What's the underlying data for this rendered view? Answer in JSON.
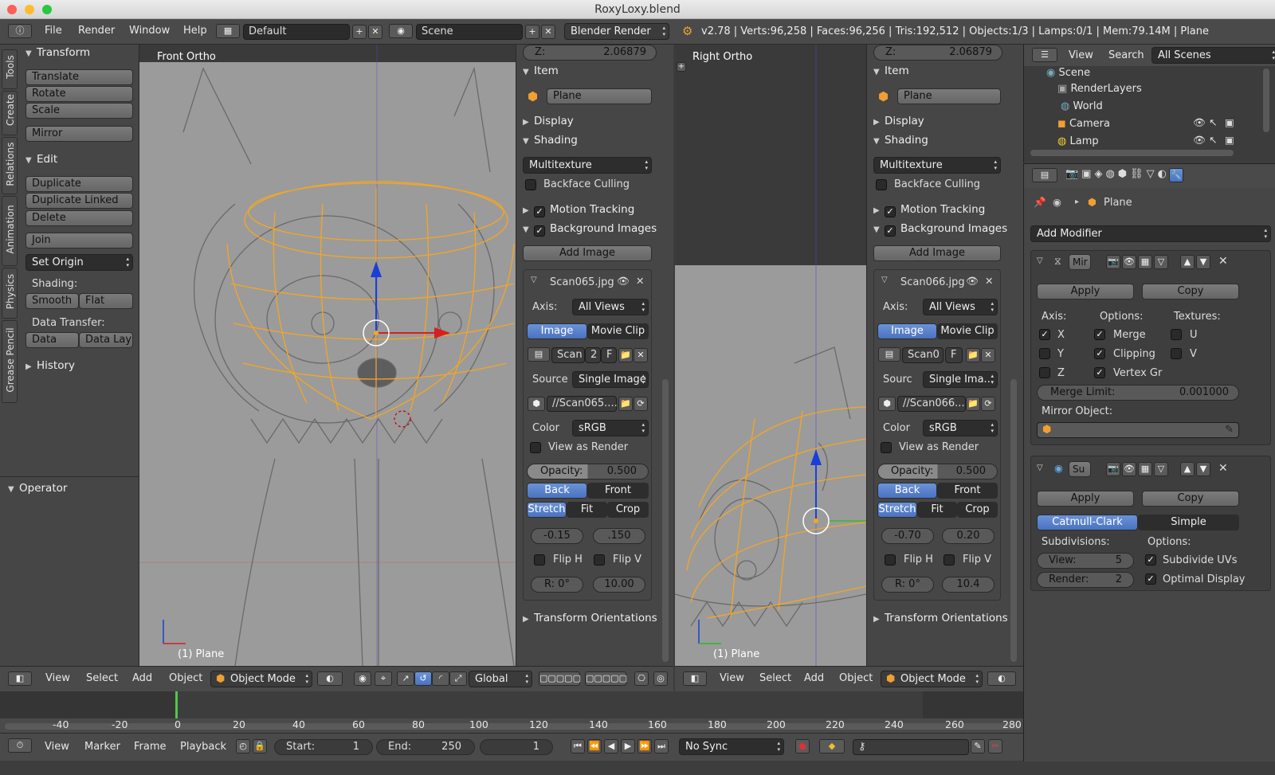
{
  "window": {
    "title": "RoxyLoxy.blend"
  },
  "info_header": {
    "menus": [
      "File",
      "Render",
      "Window",
      "Help"
    ],
    "screen_layout": "Default",
    "scene": "Scene",
    "render_engine": "Blender Render",
    "stats": "v2.78 | Verts:96,258 | Faces:96,256 | Tris:192,512 | Objects:1/3 | Lamps:0/1 | Mem:79.14M | Plane"
  },
  "tool_tabs": [
    "Tools",
    "Create",
    "Relations",
    "Animation",
    "Physics",
    "Grease Pencil"
  ],
  "tool_shelf": {
    "transform_title": "Transform",
    "translate": "Translate",
    "rotate": "Rotate",
    "scale": "Scale",
    "mirror": "Mirror",
    "edit_title": "Edit",
    "duplicate": "Duplicate",
    "duplicate_linked": "Duplicate Linked",
    "delete": "Delete",
    "join": "Join",
    "set_origin": "Set Origin",
    "shading_label": "Shading:",
    "smooth": "Smooth",
    "flat": "Flat",
    "data_transfer_label": "Data Transfer:",
    "data": "Data",
    "data_lay": "Data Lay",
    "history_title": "History",
    "operator_title": "Operator"
  },
  "viewport_left": {
    "title": "Front Ortho",
    "object_label": "(1) Plane"
  },
  "viewport_right": {
    "title": "Right Ortho",
    "object_label": "(1) Plane"
  },
  "props_left": {
    "z_label": "Z:",
    "z_value": "2.06879",
    "item_title": "Item",
    "item_name": "Plane",
    "display_title": "Display",
    "shading_title": "Shading",
    "shading_mode": "Multitexture",
    "backface_culling": "Backface Culling",
    "motion_tracking": "Motion Tracking",
    "background_images": "Background Images",
    "add_image": "Add Image",
    "image_name": "Scan065.jpg",
    "axis_label": "Axis:",
    "axis_value": "All Views",
    "image_tab": "Image",
    "movie_clip_tab": "Movie Clip",
    "scan_field": "Scan",
    "scan_users": "2",
    "scan_f": "F",
    "source_label": "Source",
    "source_value": "Single Image",
    "filepath": "//Scan065....",
    "color_label": "Color",
    "color_value": "sRGB",
    "view_as_render": "View as Render",
    "opacity_label": "Opacity:",
    "opacity_value": "0.500",
    "back": "Back",
    "front": "Front",
    "stretch": "Stretch",
    "fit": "Fit",
    "crop": "Crop",
    "offset_x": "-0.15",
    "offset_y": ".150",
    "flip_h": "Flip H",
    "flip_v": "Flip V",
    "rotation": "R: 0°",
    "size": "10.00",
    "transform_orientations": "Transform Orientations"
  },
  "props_right": {
    "z_label": "Z:",
    "z_value": "2.06879",
    "item_title": "Item",
    "item_name": "Plane",
    "display_title": "Display",
    "shading_title": "Shading",
    "shading_mode": "Multitexture",
    "backface_culling": "Backface Culling",
    "motion_tracking": "Motion Tracking",
    "background_images": "Background Images",
    "add_image": "Add Image",
    "image_name": "Scan066.jpg",
    "axis_label": "Axis:",
    "axis_value": "All Views",
    "image_tab": "Image",
    "movie_clip_tab": "Movie Clip",
    "scan_field": "Scan0",
    "scan_f": "F",
    "source_label": "Sourc",
    "source_value": "Single Ima...",
    "filepath": "//Scan066....",
    "color_label": "Color",
    "color_value": "sRGB",
    "view_as_render": "View as Render",
    "opacity_label": "Opacity:",
    "opacity_value": "0.500",
    "back": "Back",
    "front": "Front",
    "stretch": "Stretch",
    "fit": "Fit",
    "crop": "Crop",
    "offset_x": "-0.70",
    "offset_y": "0.20",
    "flip_h": "Flip H",
    "flip_v": "Flip V",
    "rotation": "R: 0°",
    "size": "10.4",
    "transform_orientations": "Transform Orientations"
  },
  "viewport_header": {
    "view": "View",
    "select": "Select",
    "add": "Add",
    "object": "Object",
    "mode": "Object Mode",
    "orientation": "Global"
  },
  "outliner": {
    "view": "View",
    "search": "Search",
    "filter": "All Scenes",
    "items": [
      "Scene",
      "RenderLayers",
      "World",
      "Camera",
      "Lamp"
    ]
  },
  "properties": {
    "object_name": "Plane",
    "add_modifier": "Add Modifier",
    "mirror_mod_name": "Mir",
    "apply": "Apply",
    "copy": "Copy",
    "axis_label": "Axis:",
    "options_label": "Options:",
    "textures_label": "Textures:",
    "x": "X",
    "y": "Y",
    "z": "Z",
    "merge": "Merge",
    "clipping": "Clipping",
    "vertex_gr": "Vertex Gr",
    "u": "U",
    "v": "V",
    "merge_limit_label": "Merge Limit:",
    "merge_limit_value": "0.001000",
    "mirror_object_label": "Mirror Object:",
    "subsurf_name": "Su",
    "catmull_clark": "Catmull-Clark",
    "simple": "Simple",
    "subdivisions_label": "Subdivisions:",
    "options2_label": "Options:",
    "view_label": "View:",
    "view_value": "5",
    "render_label": "Render:",
    "render_value": "2",
    "subdivide_uvs": "Subdivide UVs",
    "optimal_display": "Optimal Display"
  },
  "timeline": {
    "ruler": [
      "-40",
      "-20",
      "0",
      "20",
      "40",
      "60",
      "80",
      "100",
      "120",
      "140",
      "160",
      "180",
      "200",
      "220",
      "240",
      "260",
      "280"
    ],
    "view": "View",
    "marker": "Marker",
    "frame": "Frame",
    "playback": "Playback",
    "start_label": "Start:",
    "start_value": "1",
    "end_label": "End:",
    "end_value": "250",
    "current_frame": "1",
    "sync": "No Sync"
  }
}
